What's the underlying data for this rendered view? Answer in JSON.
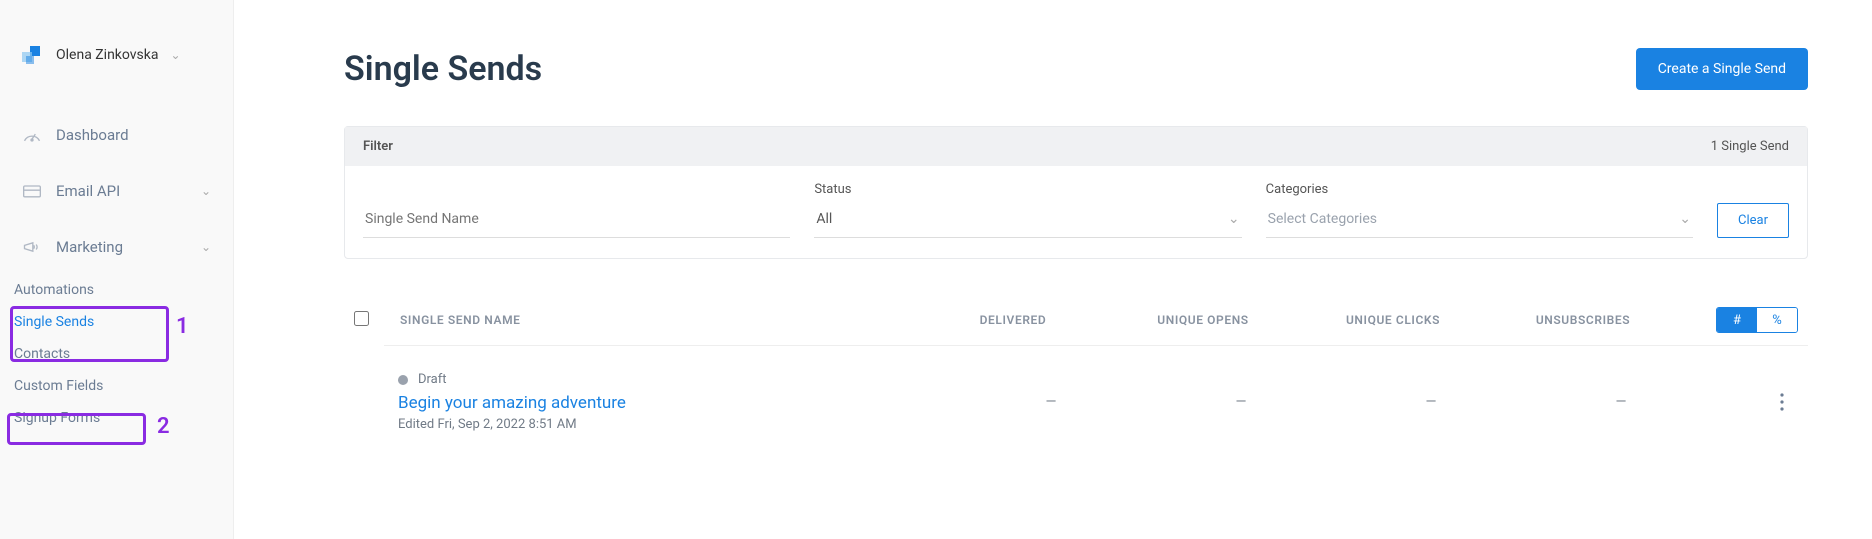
{
  "account": {
    "name": "Olena Zinkovska"
  },
  "nav": {
    "dashboard": "Dashboard",
    "email_api": "Email API",
    "marketing": "Marketing",
    "marketing_sub": {
      "automations": "Automations",
      "single_sends": "Single Sends",
      "contacts": "Contacts",
      "custom_fields": "Custom Fields",
      "signup_forms": "Signup Forms"
    }
  },
  "annotations": {
    "one": "1",
    "two": "2"
  },
  "page": {
    "title": "Single Sends",
    "create_btn": "Create a Single Send"
  },
  "filter": {
    "label": "Filter",
    "count": "1 Single Send",
    "name_placeholder": "Single Send Name",
    "status_label": "Status",
    "status_value": "All",
    "categories_label": "Categories",
    "categories_placeholder": "Select Categories",
    "clear": "Clear"
  },
  "columns": {
    "name": "SINGLE SEND NAME",
    "delivered": "DELIVERED",
    "opens": "UNIQUE OPENS",
    "clicks": "UNIQUE CLICKS",
    "unsubs": "UNSUBSCRIBES"
  },
  "toggle": {
    "hash": "#",
    "pct": "%"
  },
  "row": {
    "status": "Draft",
    "name": "Begin your amazing adventure",
    "edited": "Edited Fri, Sep 2, 2022 8:51 AM",
    "delivered": "—",
    "opens": "—",
    "clicks": "—",
    "unsubs": "—"
  }
}
